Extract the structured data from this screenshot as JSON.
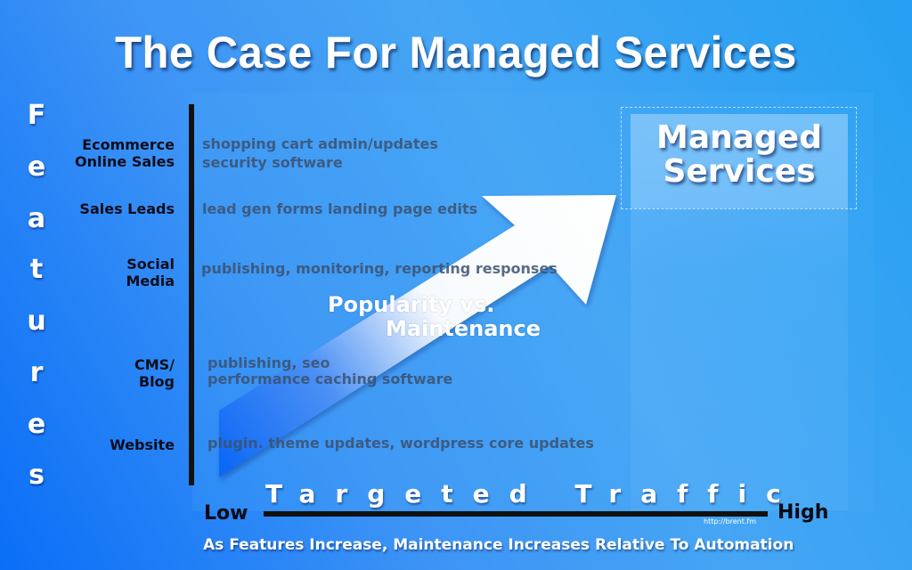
{
  "title": "The Case For Managed Services",
  "y_axis": {
    "label": "Features",
    "letters": [
      "F",
      "e",
      "a",
      "t",
      "u",
      "r",
      "e",
      "s"
    ]
  },
  "features": [
    {
      "label": "Ecommerce\nOnline Sales",
      "tasks": "shopping cart admin/updates\nsecurity software"
    },
    {
      "label": "Sales Leads",
      "tasks": "lead gen forms landing page edits"
    },
    {
      "label": "Social\nMedia",
      "tasks": "publishing, monitoring, reporting responses"
    },
    {
      "label": "CMS/\nBlog",
      "tasks": "publishing, seo\nperformance caching software"
    },
    {
      "label": "Website",
      "tasks": "plugin. theme updates, wordpress core updates"
    }
  ],
  "arrow": {
    "label_line1": "Popularity vs.",
    "label_line2": "Maintenance"
  },
  "managed_services": {
    "line1": "Managed",
    "line2": "Services"
  },
  "x_axis": {
    "label": "Targeted Traffic",
    "low": "Low",
    "high": "High"
  },
  "credit": "http://brent.fm",
  "subtitle": "As Features Increase, Maintenance Increases Relative To Automation"
}
